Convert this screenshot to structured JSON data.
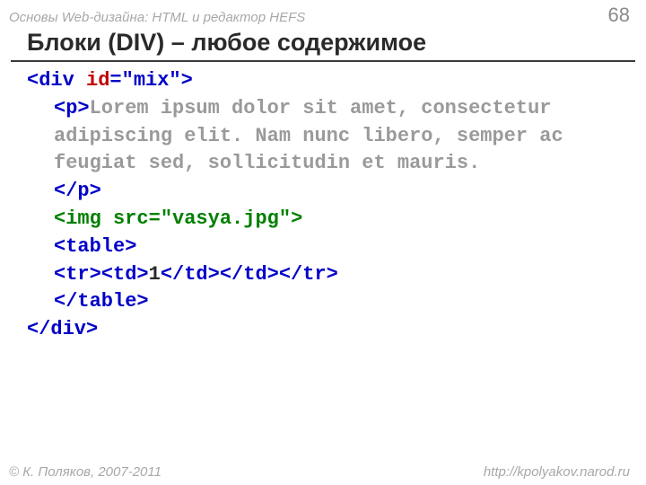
{
  "header": {
    "course": "Основы Web-дизайна: HTML и редактор HEFS",
    "slide_number": "68"
  },
  "title": "Блоки (DIV) – любое содержимое",
  "code": {
    "l1_open": "<div ",
    "l1_attr_name": "id",
    "l1_eq": "=",
    "l1_attr_val": "\"mix\"",
    "l1_close": ">",
    "l2_popen": "<p>",
    "l2_text": "Lorem ipsum dolor sit amet, consectetur adipiscing elit. Nam nunc libero, semper ac feugiat sed, sollicitudin et mauris.",
    "l3_pclose": "</p>",
    "l4_img_open": "<img ",
    "l4_img_attr": "src",
    "l4_img_eq": "=",
    "l4_img_val": "\"vasya.jpg\"",
    "l4_img_close": ">",
    "l5_table_open": "<table>",
    "l6_a": "<tr><td>",
    "l6_val": "1",
    "l6_b": "</td></td></tr>",
    "l7_table_close": "</table>",
    "l8_div_close": "</div>"
  },
  "footer": {
    "copyright": "© К. Поляков, 2007-2011",
    "url": "http://kpolyakov.narod.ru"
  }
}
